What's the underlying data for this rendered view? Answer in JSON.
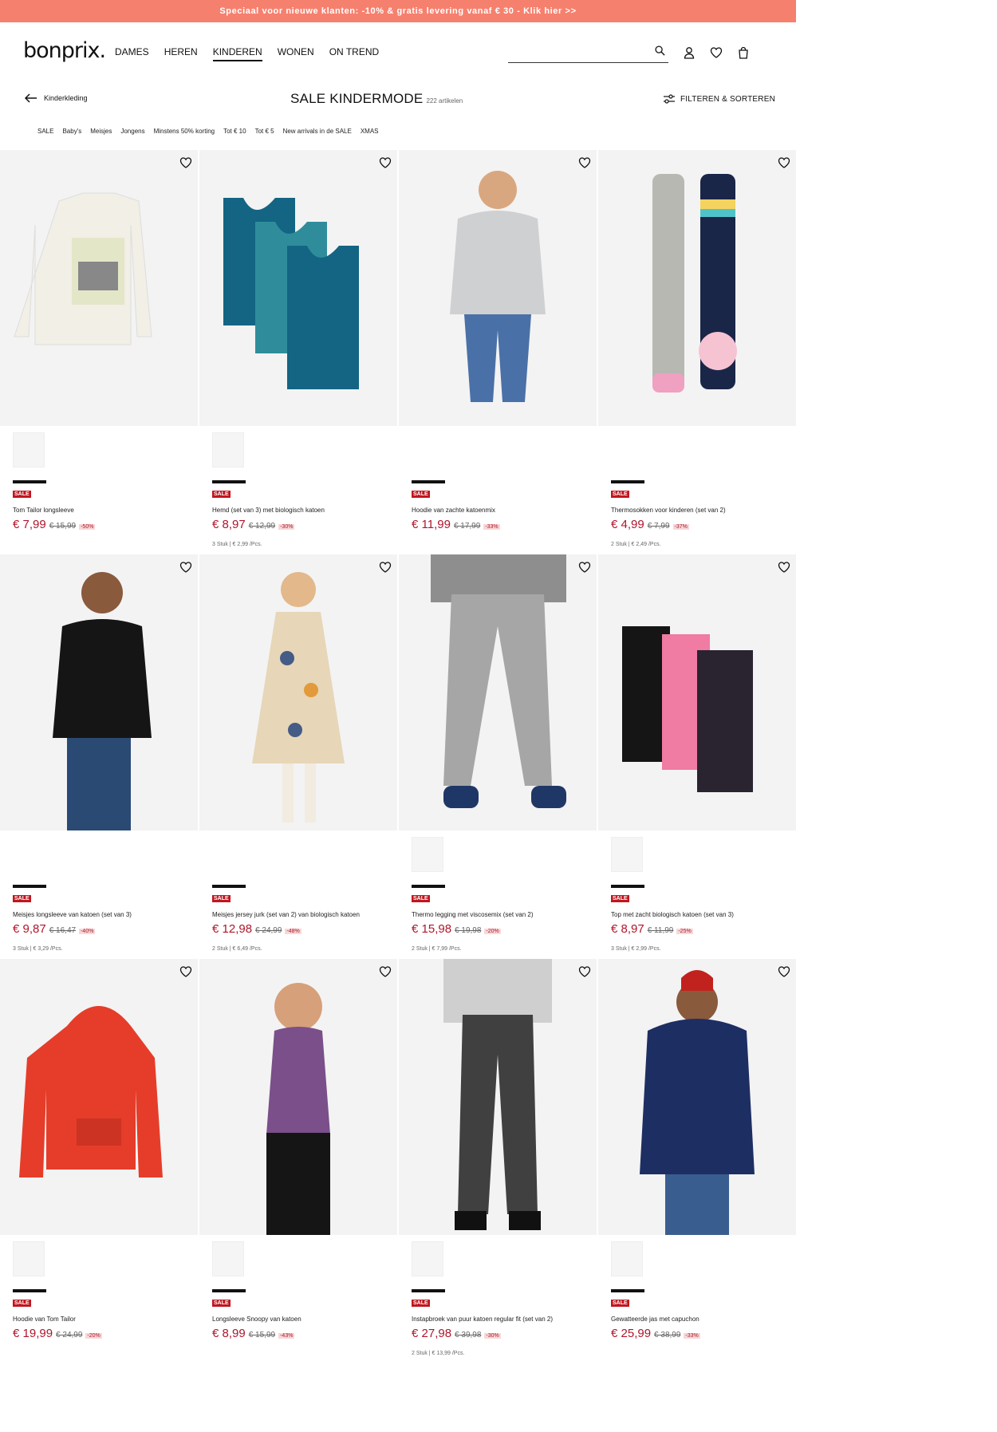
{
  "promo": {
    "text": "Speciaal voor nieuwe klanten: -10% & gratis levering vanaf € 30 - Klik hier >>"
  },
  "header": {
    "logo": "bonprix.",
    "nav": [
      "DAMES",
      "HEREN",
      "KINDEREN",
      "WONEN",
      "ON TREND"
    ],
    "active_nav": "KINDEREN",
    "search_placeholder": "",
    "icons": [
      "search-icon",
      "user-icon",
      "heart-icon",
      "bag-icon"
    ]
  },
  "subheader": {
    "back_label": "Kinderkleding",
    "title": "SALE KINDERMODE",
    "count": "222 artikelen",
    "filter_label": "FILTEREN & SORTEREN"
  },
  "chips": [
    "SALE",
    "Baby's",
    "Meisjes",
    "Jongens",
    "Minstens 50% korting",
    "Tot € 10",
    "Tot € 5",
    "New arrivals in de SALE",
    "XMAS"
  ],
  "colors": {
    "promo": "#f6806e",
    "sale": "#c0161f",
    "price": "#b0152a",
    "tile": "#f3f3f3"
  },
  "products": [
    {
      "name": "Tom Tailor longsleeve",
      "price": "€ 7,99",
      "old": "€ 15,99",
      "discount": "-50%",
      "unit": "",
      "badge": "SALE",
      "thumb": true
    },
    {
      "name": "Hemd (set van 3) met biologisch katoen",
      "price": "€ 8,97",
      "old": "€ 12,99",
      "discount": "-30%",
      "unit": "3 Stuk | € 2,99 /Pcs.",
      "badge": "SALE",
      "thumb": true
    },
    {
      "name": "Hoodie van zachte katoenmix",
      "price": "€ 11,99",
      "old": "€ 17,99",
      "discount": "-33%",
      "unit": "",
      "badge": "SALE",
      "thumb": false
    },
    {
      "name": "Thermosokken voor kinderen (set van 2)",
      "price": "€ 4,99",
      "old": "€ 7,99",
      "discount": "-37%",
      "unit": "2 Stuk | € 2,49 /Pcs.",
      "badge": "SALE",
      "thumb": false
    },
    {
      "name": "Meisjes longsleeve van katoen (set van 3)",
      "price": "€ 9,87",
      "old": "€ 16,47",
      "discount": "-40%",
      "unit": "3 Stuk | € 3,29 /Pcs.",
      "badge": "SALE",
      "thumb": false
    },
    {
      "name": "Meisjes jersey jurk (set van 2) van biologisch katoen",
      "price": "€ 12,98",
      "old": "€ 24,99",
      "discount": "-48%",
      "unit": "2 Stuk | € 6,49 /Pcs.",
      "badge": "SALE",
      "thumb": false
    },
    {
      "name": "Thermo legging met viscosemix (set van 2)",
      "price": "€ 15,98",
      "old": "€ 19,98",
      "discount": "-20%",
      "unit": "2 Stuk | € 7,99 /Pcs.",
      "badge": "SALE",
      "thumb": true
    },
    {
      "name": "Top met zacht biologisch katoen (set van 3)",
      "price": "€ 8,97",
      "old": "€ 11,99",
      "discount": "-25%",
      "unit": "3 Stuk | € 2,99 /Pcs.",
      "badge": "SALE",
      "thumb": true
    },
    {
      "name": "Hoodie van Tom Tailor",
      "price": "€ 19,99",
      "old": "€ 24,99",
      "discount": "-20%",
      "unit": "",
      "badge": "SALE",
      "thumb": true
    },
    {
      "name": "Longsleeve Snoopy van katoen",
      "price": "€ 8,99",
      "old": "€ 15,99",
      "discount": "-43%",
      "unit": "",
      "badge": "SALE",
      "thumb": true
    },
    {
      "name": "Instapbroek van puur katoen regular fit (set van 2)",
      "price": "€ 27,98",
      "old": "€ 39,98",
      "discount": "-30%",
      "unit": "2 Stuk | € 13,99 /Pcs.",
      "badge": "SALE",
      "thumb": true
    },
    {
      "name": "Gewatteerde jas met capuchon",
      "price": "€ 25,99",
      "old": "€ 38,99",
      "discount": "-33%",
      "unit": "",
      "badge": "SALE",
      "thumb": true
    }
  ]
}
